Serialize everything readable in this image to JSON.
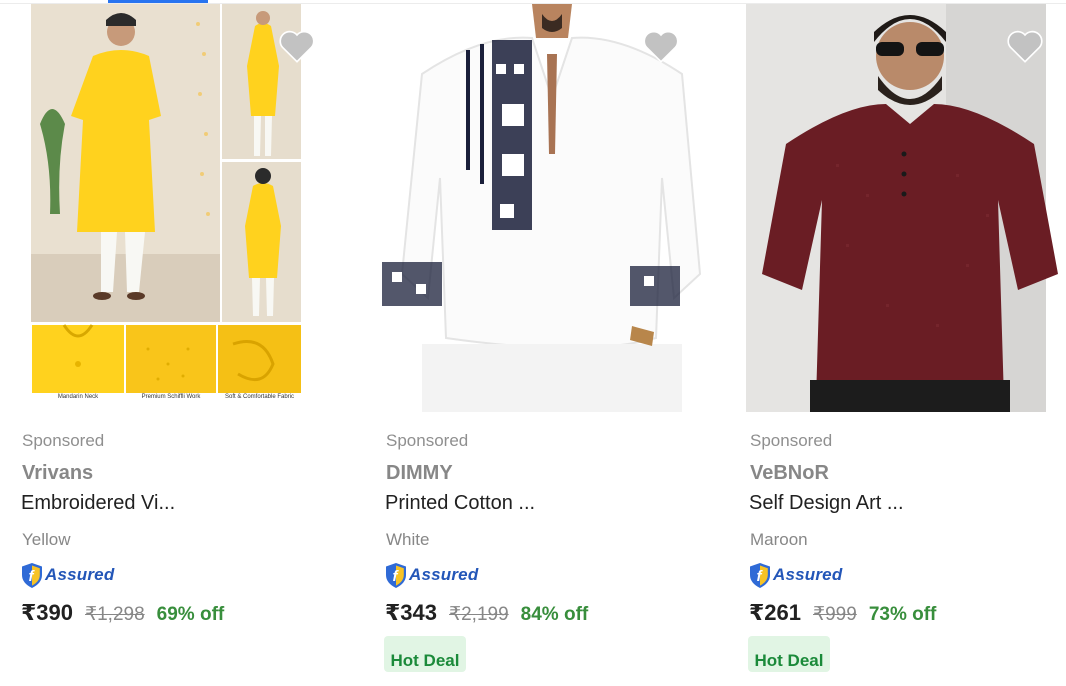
{
  "products": [
    {
      "sponsored": "Sponsored",
      "brand": "Vrivans",
      "title": "Embroidered Vi...",
      "color": "Yellow",
      "assured": "Assured",
      "price": "₹390",
      "mrp": "₹1,298",
      "discount": "69% off",
      "image_captions": [
        "Mandarin Neck",
        "Premium Schiffli Work",
        "Soft & Comfortable Fabric"
      ],
      "garment_color": "#ffd21e"
    },
    {
      "sponsored": "Sponsored",
      "brand": "DIMMY",
      "title": "Printed Cotton ...",
      "color": "White",
      "assured": "Assured",
      "price": "₹343",
      "mrp": "₹2,199",
      "discount": "84% off",
      "deal": "Hot Deal",
      "garment_color": "#ffffff"
    },
    {
      "sponsored": "Sponsored",
      "brand": "VeBNoR",
      "title": "Self Design Art ...",
      "color": "Maroon",
      "assured": "Assured",
      "price": "₹261",
      "mrp": "₹999",
      "discount": "73% off",
      "deal": "Hot Deal",
      "garment_color": "#6a1d24"
    }
  ],
  "colors": {
    "accent": "#2874f0",
    "discount": "#388e3c",
    "assured": "#2356b8",
    "deal_bg": "#e1f5e4"
  }
}
